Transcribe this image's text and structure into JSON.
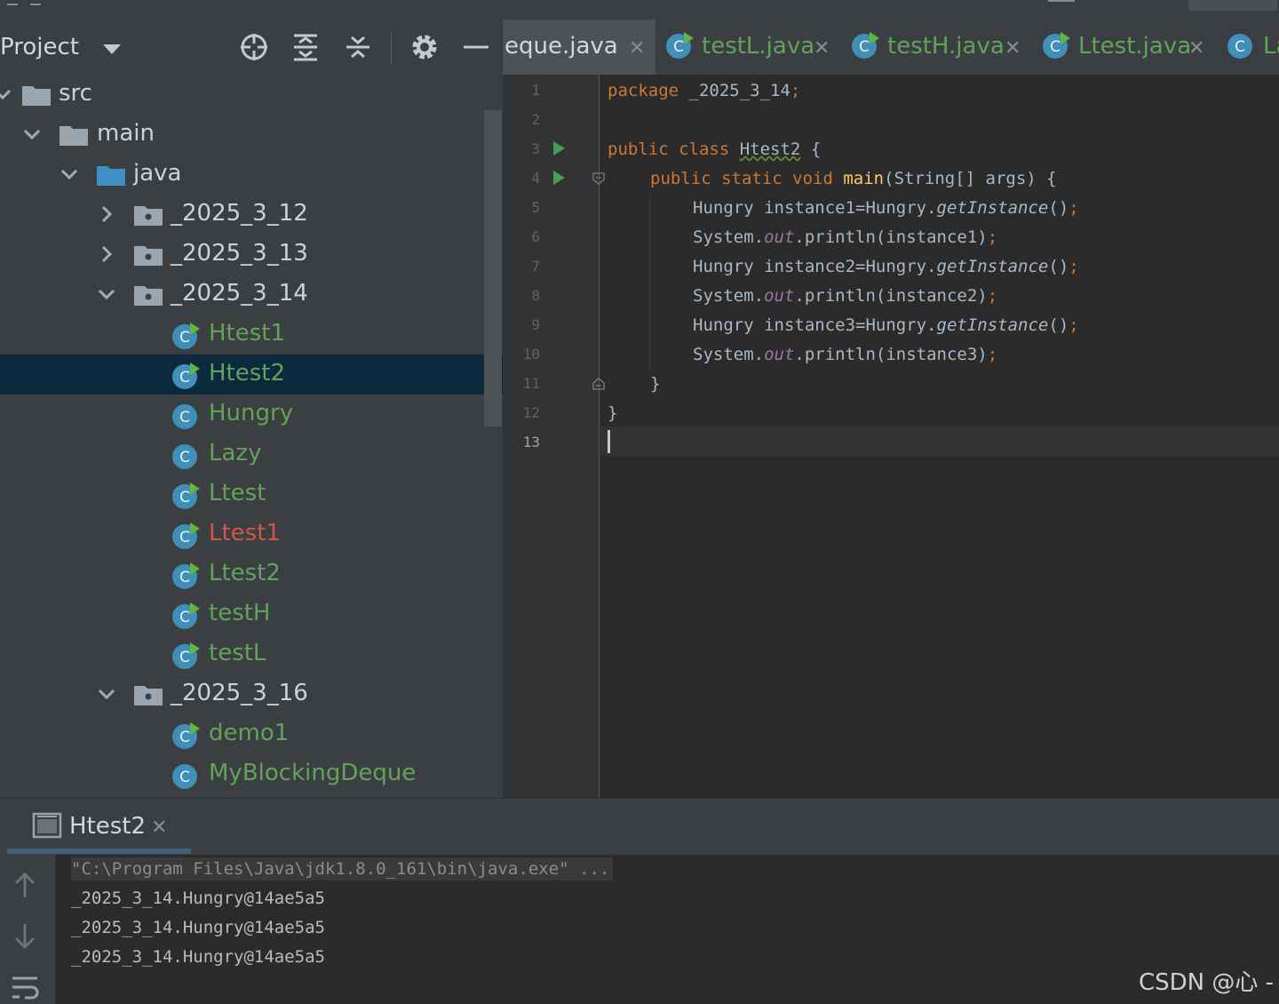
{
  "project": {
    "title": "Project",
    "tree": [
      {
        "label": "src",
        "kind": "folder-plain"
      },
      {
        "label": "main",
        "kind": "folder-plain"
      },
      {
        "label": "java",
        "kind": "folder-blue"
      },
      {
        "label": "_2025_3_12",
        "kind": "package"
      },
      {
        "label": "_2025_3_13",
        "kind": "package"
      },
      {
        "label": "_2025_3_14",
        "kind": "package"
      },
      {
        "label": "Htest1",
        "kind": "class-run"
      },
      {
        "label": "Htest2",
        "kind": "class-run",
        "selected": true
      },
      {
        "label": "Hungry",
        "kind": "class"
      },
      {
        "label": "Lazy",
        "kind": "class"
      },
      {
        "label": "Ltest",
        "kind": "class-run"
      },
      {
        "label": "Ltest1",
        "kind": "class-run",
        "error": true
      },
      {
        "label": "Ltest2",
        "kind": "class-run"
      },
      {
        "label": "testH",
        "kind": "class-run"
      },
      {
        "label": "testL",
        "kind": "class-run"
      },
      {
        "label": "_2025_3_16",
        "kind": "package"
      },
      {
        "label": "demo1",
        "kind": "class-run"
      },
      {
        "label": "MyBlockingDeque",
        "kind": "class"
      }
    ]
  },
  "tabs": [
    {
      "label": "eque.java",
      "active": true
    },
    {
      "label": "testL.java"
    },
    {
      "label": "testH.java"
    },
    {
      "label": "Ltest.java"
    },
    {
      "label": "La"
    }
  ],
  "editor": {
    "line_numbers": [
      "1",
      "2",
      "3",
      "4",
      "5",
      "6",
      "7",
      "8",
      "9",
      "10",
      "11",
      "12",
      "13"
    ],
    "lines": {
      "l1_kw": "package",
      "l1_rest": " _2025_3_14",
      "l1_semi": ";",
      "l3_kw": "public class",
      "l3_name": "Htest2",
      "l3_rest": " {",
      "l4_kw": "public static void",
      "l4_fn": "main",
      "l4_rest": "(String[] args) {",
      "l5_a": "Hungry instance1=Hungry.",
      "l5_it": "getInstance",
      "l5_b": "()",
      "l5_semi": ";",
      "l6_a": "System.",
      "l6_st": "out",
      "l6_b": ".println(instance1)",
      "l6_semi": ";",
      "l7_a": "Hungry instance2=Hungry.",
      "l7_it": "getInstance",
      "l7_b": "()",
      "l7_semi": ";",
      "l8_a": "System.",
      "l8_st": "out",
      "l8_b": ".println(instance2)",
      "l8_semi": ";",
      "l9_a": "Hungry instance3=Hungry.",
      "l9_it": "getInstance",
      "l9_b": "()",
      "l9_semi": ";",
      "l10_a": "System.",
      "l10_st": "out",
      "l10_b": ".println(instance3)",
      "l10_semi": ";",
      "l11": "}",
      "l12": "}"
    }
  },
  "run": {
    "tab_label": "Htest2",
    "console": [
      "\"C:\\Program Files\\Java\\jdk1.8.0_161\\bin\\java.exe\" ...",
      "_2025_3_14.Hungry@14ae5a5",
      "_2025_3_14.Hungry@14ae5a5",
      "_2025_3_14.Hungry@14ae5a5"
    ]
  },
  "watermark": "CSDN @心 -",
  "colors": {
    "keyword": "#cc7832",
    "function": "#ffc66d",
    "static_field": "#9876aa",
    "vcs_added": "#62a25a",
    "error": "#d2544f",
    "selection": "#0d293e"
  }
}
